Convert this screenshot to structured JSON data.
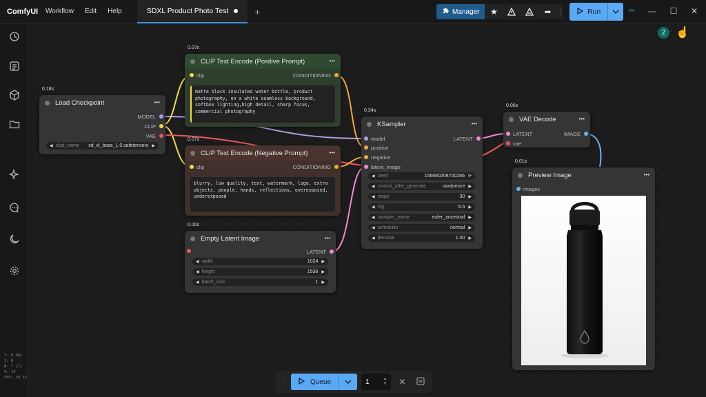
{
  "app": {
    "name": "ComfyUI"
  },
  "menu": [
    "Workflow",
    "Edit",
    "Help"
  ],
  "tab": {
    "title": "SDXL Product Photo Test"
  },
  "toolbar": {
    "manager_label": "Manager",
    "run_label": "Run"
  },
  "badge_count": "2",
  "stats": [
    "T: 0.00s",
    "I: 0",
    "N: 7 [7]",
    "V: 14",
    "FPS: 59.52"
  ],
  "nodes": {
    "load_checkpoint": {
      "time": "0.18s",
      "title": "Load Checkpoint",
      "outputs": [
        "MODEL",
        "CLIP",
        "VAE"
      ],
      "widget_name": "ckpt_name",
      "widget_value": "sd_xl_base_1.0.safetensors"
    },
    "clip_pos": {
      "time": "0.07s",
      "title": "CLIP Text Encode (Positive Prompt)",
      "input": "clip",
      "output": "CONDITIONING",
      "text": "matte black insulated water bottle, product photography, on a white seamless background, softbox lighting,high detail, sharp focus, commercial photography"
    },
    "clip_neg": {
      "time": "0.07s",
      "title": "CLIP Text Encode (Negative Prompt)",
      "input": "clip",
      "output": "CONDITIONING",
      "text": "blurry, low quality, text, watermark, logo, extra objects, people, hands, reflections, overexposed, underexposed"
    },
    "empty_latent": {
      "time": "0.00s",
      "title": "Empty Latent Image",
      "output": "LATENT",
      "widgets": [
        {
          "name": "width",
          "value": "1024"
        },
        {
          "name": "height",
          "value": "1536"
        },
        {
          "name": "batch_size",
          "value": "1"
        }
      ]
    },
    "ksampler": {
      "time": "0.34s",
      "title": "KSampler",
      "output": "LATENT",
      "inputs": [
        "model",
        "positive",
        "negative",
        "latent_image"
      ],
      "widgets": [
        {
          "name": "seed",
          "value": "156680208700286"
        },
        {
          "name": "control_after_generate",
          "value": "randomize"
        },
        {
          "name": "steps",
          "value": "30"
        },
        {
          "name": "cfg",
          "value": "6.5"
        },
        {
          "name": "sampler_name",
          "value": "euler_ancestral"
        },
        {
          "name": "scheduler",
          "value": "normal"
        },
        {
          "name": "denoise",
          "value": "1.00"
        }
      ]
    },
    "vae_decode": {
      "time": "0.06s",
      "title": "VAE Decode",
      "inputs": [
        "LATENT",
        "vae"
      ],
      "output": "IMAGE"
    },
    "preview": {
      "time": "0.01s",
      "title": "Preview Image",
      "input": "images"
    }
  },
  "queue": {
    "label": "Queue",
    "count": "1"
  },
  "colors": {
    "accent": "#5aa9f5",
    "manager": "#1f5c8c",
    "clip_pos_bg": "#2f4a30",
    "clip_neg_bg": "#4a322e",
    "port_model": "#b49ee8",
    "port_clip": "#f5d94a",
    "port_vae": "#f0565c",
    "port_cond": "#f7a43c",
    "port_latent": "#f28ad0",
    "port_image": "#64b5f6"
  }
}
